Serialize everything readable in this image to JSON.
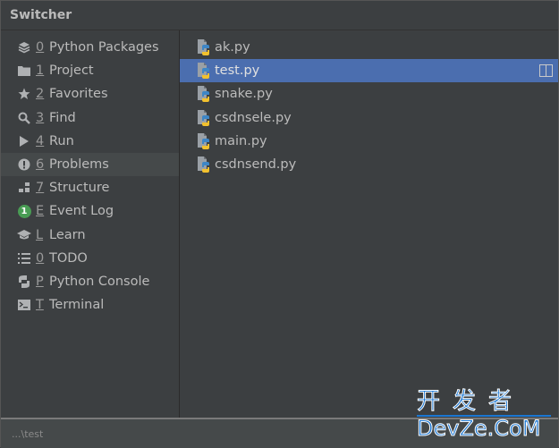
{
  "window": {
    "title": "Switcher"
  },
  "tool_windows": [
    {
      "mnemonic": "0",
      "label": "Python Packages",
      "icon": "layers-icon"
    },
    {
      "mnemonic": "1",
      "label": "Project",
      "icon": "folder-icon"
    },
    {
      "mnemonic": "2",
      "label": "Favorites",
      "icon": "star-icon"
    },
    {
      "mnemonic": "3",
      "label": "Find",
      "icon": "search-icon"
    },
    {
      "mnemonic": "4",
      "label": "Run",
      "icon": "play-icon"
    },
    {
      "mnemonic": "6",
      "label": "Problems",
      "icon": "warning-icon",
      "selected": true
    },
    {
      "mnemonic": "7",
      "label": "Structure",
      "icon": "structure-icon"
    },
    {
      "mnemonic": "E",
      "label": "Event Log",
      "icon": "event-log-badge-icon",
      "badge": "1"
    },
    {
      "mnemonic": "L",
      "label": "Learn",
      "icon": "graduation-cap-icon"
    },
    {
      "mnemonic": "0",
      "label": "TODO",
      "icon": "list-icon"
    },
    {
      "mnemonic": "P",
      "label": "Python Console",
      "icon": "python-icon"
    },
    {
      "mnemonic": "T",
      "label": "Terminal",
      "icon": "terminal-icon"
    }
  ],
  "files": [
    {
      "name": "ak.py"
    },
    {
      "name": "test.py",
      "selected": true
    },
    {
      "name": "snake.py"
    },
    {
      "name": "csdnsele.py"
    },
    {
      "name": "main.py"
    },
    {
      "name": "csdnsend.py"
    }
  ],
  "status": {
    "path": "...\\test"
  },
  "watermark": {
    "cn": "开发者",
    "en": "DevZe.CoM"
  },
  "colors": {
    "selection": "#4b6eaf",
    "badge": "#499c54"
  }
}
